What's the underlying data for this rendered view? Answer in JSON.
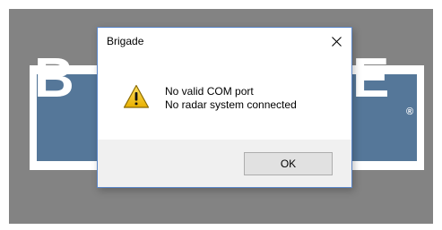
{
  "background": {
    "backdrop_color": "#838383",
    "logo": {
      "left_letters": "B",
      "right_letters": "E",
      "registered_mark": "®",
      "band_color": "#557799"
    }
  },
  "dialog": {
    "title": "Brigade",
    "close_icon": "close-icon",
    "icon": "warning-icon",
    "messages": [
      "No valid COM port",
      "No radar system connected"
    ],
    "ok_label": "OK",
    "border_color": "#5a86c9",
    "footer_color": "#f0f0f0"
  }
}
